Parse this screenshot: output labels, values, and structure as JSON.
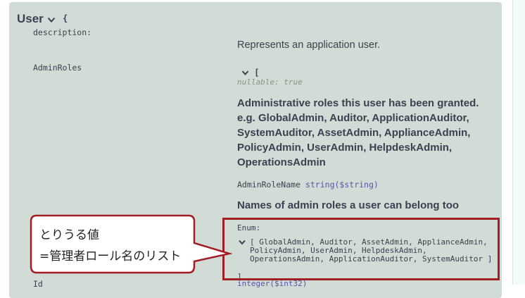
{
  "model": {
    "name": "User",
    "open_brace": "{"
  },
  "properties": {
    "description": {
      "name": "description:",
      "value": "Represents an application user."
    },
    "admin_roles": {
      "name": "AdminRoles",
      "array_open": "[",
      "nullable": "nullable: true",
      "description": "Administrative roles this user has been granted. e.g. GlobalAdmin, Auditor, ApplicationAuditor, SystemAuditor, AssetAdmin, ApplianceAdmin, PolicyAdmin, UserAdmin, HelpdeskAdmin, OperationsAdmin",
      "element_name": "AdminRoleName",
      "element_type": "string($string)",
      "element_description": "Names of admin roles a user can belong too",
      "enum_label": "Enum:",
      "enum_values": "[ GlobalAdmin, Auditor, AssetAdmin, ApplianceAdmin, PolicyAdmin, UserAdmin, HelpdeskAdmin, OperationsAdmin, ApplicationAuditor, SystemAuditor ]",
      "array_close": "]"
    },
    "id": {
      "name": "Id",
      "type": "integer($int32)"
    }
  },
  "annotation": {
    "line1": "とりうる値",
    "line2": "=管理者ロール名のリスト"
  },
  "colors": {
    "panel": "#d1dcd6",
    "text": "#3b4151",
    "highlight_border": "#a31e24",
    "callout_border": "#a31e24",
    "type_keyword": "#5555aa"
  }
}
